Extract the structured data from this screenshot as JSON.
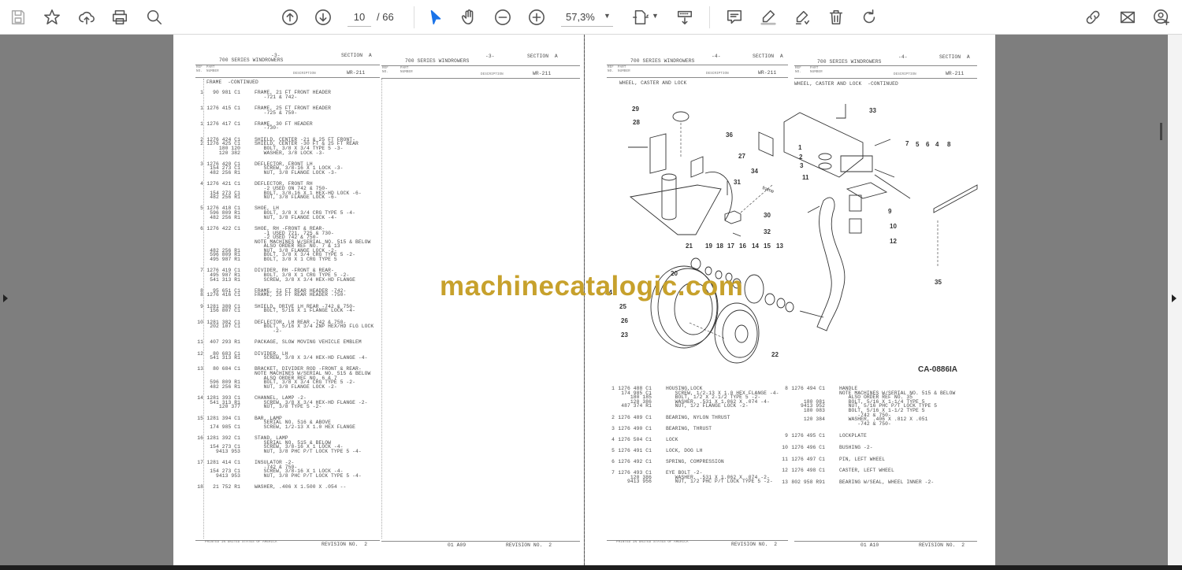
{
  "toolbar": {
    "current_page": "10",
    "total_pages": "/ 66",
    "zoom": "57,3%",
    "accent": "#1a73e8"
  },
  "left_page": {
    "sheet1": {
      "series": "700 SERIES WINDROWERS",
      "page": "-3-",
      "section": "SECTION  A",
      "ref_label": "REF\nNO.",
      "part_label": "PART\nNUMBER",
      "desc_label": "DESCRIPTION",
      "code": "WR-211",
      "title": "FRAME  -CONTINUED",
      "groups": [
        [
          [
            "1",
            "90 981 C1",
            "FRAME, 21 FT FRONT HEADER"
          ],
          [
            "",
            "",
            "   -721 & 742-"
          ]
        ],
        [
          [
            "1",
            "1276 415 C1",
            "FRAME, 25 FT FRONT HEADER"
          ],
          [
            "",
            "",
            "   -725 & 750-"
          ]
        ],
        [
          [
            "1",
            "1276 417 C1",
            "FRAME, 30 FT HEADER"
          ],
          [
            "",
            "",
            "   -730-"
          ]
        ],
        [
          [
            "2",
            "1276 424 C1",
            "SHIELD, CENTER -21 & 25 FT FRONT-"
          ],
          [
            "2",
            "1276 425 C1",
            "SHIELD, CENTER -30 FT & 25 FT REAR"
          ],
          [
            "",
            "180 120",
            "   BOLT, 3/8 X 3/4 TYPE 5 -3-"
          ],
          [
            "",
            "120 382",
            "   WASHER, 3/8 LOCK -3-"
          ]
        ],
        [
          [
            "3",
            "1276 420 C1",
            "DEFLECTOR, FRONT LH"
          ],
          [
            "",
            "154 273 C1",
            "   SCREW, 3/8-16 X 1 LOCK -3-"
          ],
          [
            "",
            "482 256 R1",
            "   NUT, 3/8 FLANGE LOCK -3-"
          ]
        ],
        [
          [
            "4",
            "1276 421 C1",
            "DEFLECTOR, FRONT RH"
          ],
          [
            "",
            "",
            "   -2 USED ON 742 & 750-"
          ],
          [
            "",
            "154 273 C1",
            "   BOLT, 3/8-16 X 1 HEX-HD LOCK -6-"
          ],
          [
            "",
            "482 256 R1",
            "   NUT, 3/8 FLANGE LOCK -6-"
          ]
        ],
        [
          [
            "5",
            "1276 418 C1",
            "SHOE, LH"
          ],
          [
            "",
            "596 809 R1",
            "   BOLT, 3/8 X 3/4 CRG TYPE 5 -4-"
          ],
          [
            "",
            "482 256 R1",
            "   NUT, 3/8 FLANGE LOCK -4-"
          ]
        ],
        [
          [
            "6",
            "1276 422 C1",
            "SHOE, RH -FRONT & REAR-"
          ],
          [
            "",
            "",
            "   -1 USED 721, 725 & 730-"
          ],
          [
            "",
            "",
            "   -2 USED 742 & 750-"
          ],
          [
            "",
            "",
            "NOTE MACHINES W/SERIAL NO. 515 & BELOW"
          ],
          [
            "",
            "",
            "   ALSO ORDER REF NO. 7 & 13"
          ],
          [
            "",
            "482 256 R1",
            "   NUT, 3/8 FLANGE LOCK -2-"
          ],
          [
            "",
            "596 809 R1",
            "   BOLT, 3/8 X 3/4 CRG TYPE 5 -2-"
          ],
          [
            "",
            "495 987 R1",
            "   BOLT, 3/8 X 1 CRG TYPE 5"
          ]
        ],
        [
          [
            "7",
            "1276 419 C1",
            "DIVIDER, RH -FRONT & REAR-"
          ],
          [
            "",
            "495 987 R1",
            "   BOLT, 3/8 X 1 CRG TYPE 5 -2-"
          ],
          [
            "",
            "541 313 R1",
            "   SCREW, 3/8 X 3/4 HEX-HD FLANGE"
          ]
        ],
        [
          [
            "8",
            "95 651 C1",
            "FRAME, 21 FT REAR HEADER -742-"
          ],
          [
            "8",
            "1276 416 C1",
            "FRAME, 25 FT REAR HEADER -750-"
          ]
        ],
        [
          [
            "9",
            "1281 380 C1",
            "SHIELD, DRIVE LH REAR -742 & 750-"
          ],
          [
            "",
            "156 807 C1",
            "   BOLT, 5/16 X 1 FLANGE LOCK -4-"
          ]
        ],
        [
          [
            "10",
            "1281 382 C1",
            "DEFLECTOR, LH REAR -742 & 750-"
          ],
          [
            "",
            "202 107 C1",
            "   BOLT, 5/16 X 3/4 ZNP HEX/HD FLG LOCK"
          ],
          [
            "",
            "",
            "      -2-"
          ]
        ],
        [
          [
            "11",
            "407 293 R1",
            "PACKAGE, SLOW MOVING VEHICLE EMBLEM"
          ]
        ],
        [
          [
            "12",
            "80 683 C1",
            "DIVIDER, LH"
          ],
          [
            "",
            "541 313 R1",
            "   SCREW, 3/8 X 3/4 HEX-HD FLANGE -4-"
          ]
        ],
        [
          [
            "13",
            "80 684 C1",
            "BRACKET, DIVIDER ROD -FRONT & REAR-"
          ],
          [
            "",
            "",
            "NOTE MACHINES W/SERIAL NO. 515 & BELOW"
          ],
          [
            "",
            "",
            "   ALSO ORDER REF NO. 6 & 7"
          ],
          [
            "",
            "596 809 R1",
            "   BOLT, 3/8 X 3/4 CRG TYPE 5 -2-"
          ],
          [
            "",
            "482 256 R1",
            "   NUT, 3/8 FLANGE LOCK -2-"
          ]
        ],
        [
          [
            "14",
            "1281 393 C1",
            "CHANNEL, LAMP -2-"
          ],
          [
            "",
            "541 313 R1",
            "   SCREW, 3/8 X 3/4 HEX-HD FLANGE -2-"
          ],
          [
            "",
            "120 377",
            "   NUT, 3/8 TYPE 5 -2-"
          ]
        ],
        [
          [
            "15",
            "1281 394 C1",
            "BAR, LAMP"
          ],
          [
            "",
            "",
            "   SERIAL NO. 516 & ABOVE"
          ],
          [
            "",
            "174 985 C1",
            "   SCREW, 1/2-13 X 1.0 HEX FLANGE"
          ]
        ],
        [
          [
            "16",
            "1281 392 C1",
            "STAND, LAMP"
          ],
          [
            "",
            "",
            "   SERIAL NO. 515 & BELOW"
          ],
          [
            "",
            "154 273 C1",
            "   SCREW, 3/8-16 X 1 LOCK -4-"
          ],
          [
            "",
            "9413 953",
            "   NUT, 3/8 PHC P/T LOCK TYPE 5 -4-"
          ]
        ],
        [
          [
            "17",
            "1281 414 C1",
            "INSULATOR -2-"
          ],
          [
            "",
            "",
            "   -742 & 750-"
          ],
          [
            "",
            "154 273 C1",
            "   SCREW, 3/8-16 X 1 LOCK -4-"
          ],
          [
            "",
            "9413 953",
            "   NUT, 3/8 PHC P/T LOCK TYPE 5 -4-"
          ]
        ],
        [
          [
            "18",
            "21 752 R1",
            "WASHER, .406 X 1.500 X .054 --"
          ]
        ]
      ],
      "printed": "PRINTED IN UNITED STATES OF AMERICA",
      "revision": "REVISION NO.  2"
    },
    "sheet2": {
      "series": "700 SERIES WINDROWERS",
      "page": "-3-",
      "section": "SECTION  A",
      "ref_label": "REF\nNO.",
      "part_label": "PART\nNUMBER",
      "desc_label": "DESCRIPTION",
      "code": "WR-211",
      "footer_code": "01 A09",
      "revision": "REVISION NO.  2"
    }
  },
  "right_page": {
    "sheet1": {
      "series": "700 SERIES WINDROWERS",
      "page": "-4-",
      "section": "SECTION  A",
      "ref_label": "REF\nNO.",
      "part_label": "PART\nNUMBER",
      "desc_label": "DESCRIPTION",
      "code": "WR-211",
      "title": "WHEEL, CASTER AND LOCK",
      "groups": [
        [
          [
            "1",
            "1276 488 C1",
            "HOUSING,LOCK"
          ],
          [
            "",
            "174 985 C1",
            "   SCREW, 1/2-13 X 1.0 HEX FLANGE -4-"
          ],
          [
            "",
            "180 185",
            "   BOLT, 1/2 X 2-1/2 TYPE 5 -2-"
          ],
          [
            "",
            "120 386",
            "   WASHER, .531 X 1.062 X .074 -4-"
          ],
          [
            "",
            "487 374 R1",
            "   NUT, 1/2 FLANGE LOCK -2-"
          ]
        ],
        [
          [
            "2",
            "1276 489 C1",
            "BEARING, NYLON THRUST"
          ]
        ],
        [
          [
            "3",
            "1276 490 C1",
            "BEARING, THRUST"
          ]
        ],
        [
          [
            "4",
            "1276 504 C1",
            "LOCK"
          ]
        ],
        [
          [
            "5",
            "1276 491 C1",
            "LOCK, DOG LH"
          ]
        ],
        [
          [
            "6",
            "1276 492 C1",
            "SPRING, COMPRESSION"
          ]
        ],
        [
          [
            "7",
            "1276 493 C1",
            "EYE BOLT -2-"
          ],
          [
            "",
            "120 386",
            "   WASHER, .531 X 1.062 X .074 -2-"
          ],
          [
            "",
            "9413 956",
            "   NUT, 1/2 PHC P/T LOCK TYPE 5 -2-"
          ]
        ]
      ],
      "printed": "PRINTED IN UNITED STATES OF AMERICA",
      "revision": "REVISION NO.  2"
    },
    "sheet2": {
      "series": "700 SERIES WINDROWERS",
      "page": "-4-",
      "section": "SECTION  A",
      "ref_label": "REF\nNO.",
      "part_label": "PART\nNUMBER",
      "desc_label": "DESCRIPTION",
      "code": "WR-211",
      "title": "WHEEL, CASTER AND LOCK  -CONTINUED",
      "groups": [
        [
          [
            "8",
            "1276 494 C1",
            "HANDLE"
          ],
          [
            "",
            "",
            "NOTE MACHINES W/SERIAL NO. 515 & BELOW"
          ],
          [
            "",
            "",
            "   ALSO ORDER REF NO. 35"
          ],
          [
            "",
            "180 081",
            "   BOLT, 5/16 X 1-1/4 TYPE 5"
          ],
          [
            "",
            "9413 952",
            "   NUT, 5/16 PHC P/T LOCK TYPE 5"
          ],
          [
            "",
            "180 083",
            "   BOLT, 5/16 X 1-1/2 TYPE 5"
          ],
          [
            "",
            "",
            "      -742 & 750-"
          ],
          [
            "",
            "120 384",
            "   WASHER, .406 X .812 X .051"
          ],
          [
            "",
            "",
            "      -742 & 750-"
          ]
        ],
        [
          [
            "9",
            "1276 495 C1",
            "LOCKPLATE"
          ]
        ],
        [
          [
            "10",
            "1276 496 C1",
            "BUSHING -2-"
          ]
        ],
        [
          [
            "11",
            "1276 497 C1",
            "PIN, LEFT WHEEL"
          ]
        ],
        [
          [
            "12",
            "1276 498 C1",
            "CASTER, LEFT WHEEL"
          ]
        ],
        [
          [
            "13",
            "802 958 R91",
            "BEARING W/SEAL, WHEEL INNER -2-"
          ]
        ]
      ],
      "footer_code": "01 A10",
      "revision": "REVISION NO.  2"
    },
    "diagram": {
      "drawing_id": "CA-0886IA",
      "frame_label": "frame",
      "callouts": [
        "1",
        "2",
        "3",
        "4",
        "5",
        "6",
        "7",
        "8",
        "9",
        "10",
        "11",
        "12",
        "13",
        "14",
        "15",
        "16",
        "17",
        "18",
        "19",
        "20",
        "21",
        "22",
        "23",
        "24",
        "25",
        "26",
        "27",
        "28",
        "29",
        "30",
        "31",
        "32",
        "33",
        "34",
        "35",
        "36"
      ]
    }
  },
  "watermark": "machinecatalogic.com"
}
